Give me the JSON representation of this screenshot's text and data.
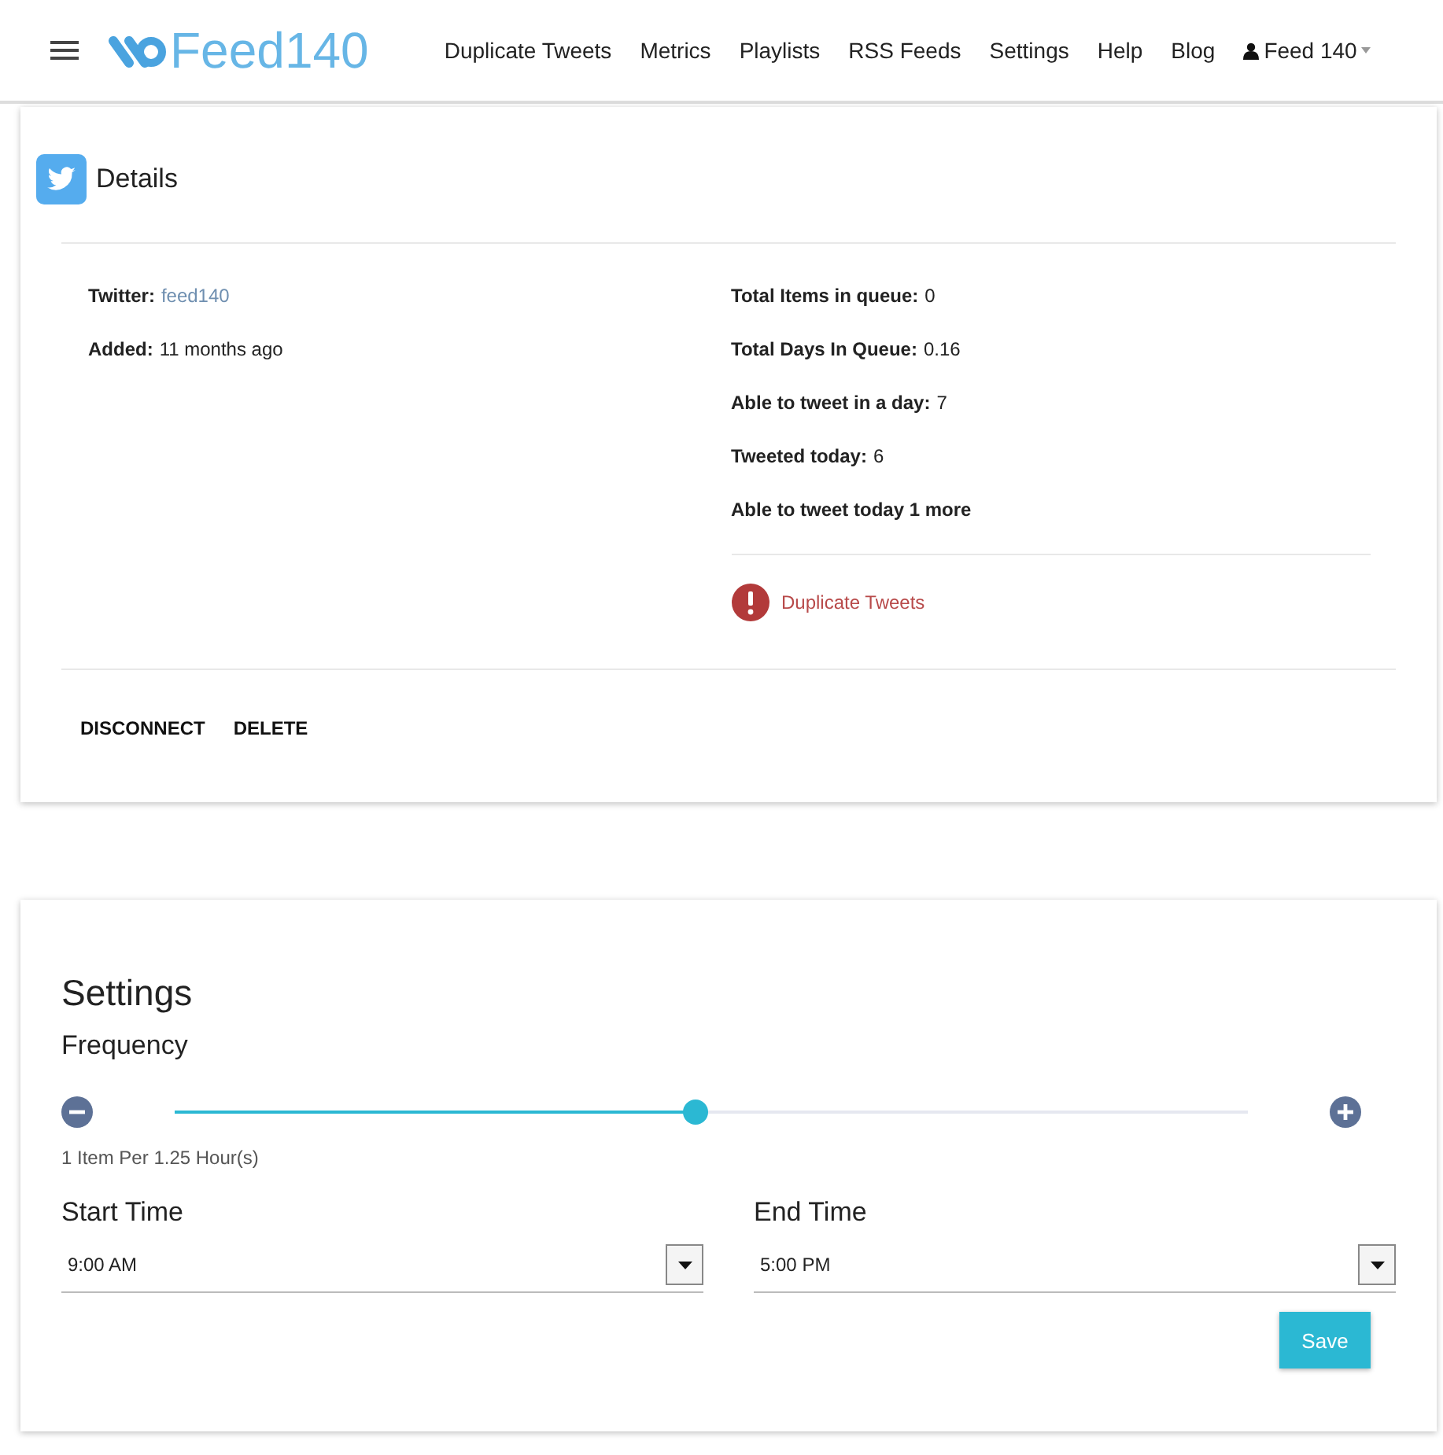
{
  "navbar": {
    "logo": "Feed140",
    "links": [
      "Duplicate Tweets",
      "Metrics",
      "Playlists",
      "RSS Feeds",
      "Settings",
      "Help",
      "Blog"
    ],
    "user": "Feed 140"
  },
  "details": {
    "title": "Details",
    "left": [
      {
        "label": "Twitter:",
        "value": "feed140",
        "kind": "link"
      },
      {
        "label": "Added:",
        "value": "11 months ago",
        "kind": "text"
      }
    ],
    "right": [
      {
        "label": "Total Items in queue:",
        "value": "0"
      },
      {
        "label": "Total Days In Queue:",
        "value": "0.16"
      },
      {
        "label": "Able to tweet in a day:",
        "value": "7"
      },
      {
        "label": "Tweeted today:",
        "value": "6"
      },
      {
        "label": "Able to tweet today 1 more"
      }
    ],
    "alert": "Duplicate Tweets",
    "actions": [
      "DISCONNECT",
      "DELETE"
    ]
  },
  "settings": {
    "title": "Settings",
    "frequency_label": "Frequency",
    "frequency": {
      "level": 0.485
    },
    "frequency_reading": "1 Item Per 1.25 Hour(s)",
    "fields": [
      {
        "label": "Start Time",
        "value": "9:00 AM"
      },
      {
        "label": "End Time",
        "value": "5:00 PM"
      }
    ],
    "save": "Save"
  }
}
